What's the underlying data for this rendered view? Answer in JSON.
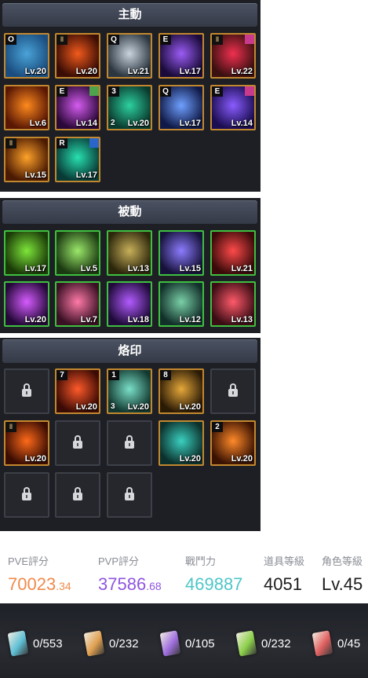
{
  "sections": {
    "active": {
      "title": "主動"
    },
    "passive": {
      "title": "被動"
    },
    "brand": {
      "title": "烙印"
    }
  },
  "active_skills": [
    {
      "name": "glaive-skill-icon",
      "tag": "O",
      "level": "Lv.20",
      "border": "gold",
      "colors": [
        "#4aa3d8",
        "#1b4e80"
      ]
    },
    {
      "name": "vortex-skill-icon",
      "level": "Lv.20",
      "border": "gold",
      "pill": "ǁ",
      "colors": [
        "#f25a1c",
        "#3a0d05"
      ]
    },
    {
      "name": "spear-dash-skill-icon",
      "tag": "Q",
      "level": "Lv.21",
      "border": "gold",
      "colors": [
        "#c9d4df",
        "#2b3640"
      ]
    },
    {
      "name": "dark-orb-skill-icon",
      "tag": "E",
      "level": "Lv.17",
      "border": "gold",
      "colors": [
        "#9b5cf5",
        "#1a0b3a"
      ]
    },
    {
      "name": "blade-rock-skill-icon",
      "level": "Lv.22",
      "border": "gold",
      "pill": "ǁ",
      "corner": "pink",
      "colors": [
        "#f03050",
        "#3a1010"
      ]
    },
    {
      "name": "flame-claw-skill-icon",
      "level": "Lv.6",
      "border": "gold",
      "colors": [
        "#ff8a1e",
        "#5a1804"
      ]
    },
    {
      "name": "purple-spikes-skill-icon",
      "tag": "E",
      "level": "Lv.14",
      "border": "gold",
      "corner": "green",
      "colors": [
        "#d55cf0",
        "#2a0838"
      ]
    },
    {
      "name": "green-hand-skill-icon",
      "tag": "3",
      "sub": "2",
      "level": "Lv.20",
      "border": "gold",
      "colors": [
        "#2dd1a0",
        "#0a3a2e"
      ]
    },
    {
      "name": "light-pillar-skill-icon",
      "tag": "Q",
      "level": "Lv.17",
      "border": "gold",
      "colors": [
        "#6fa0ff",
        "#101a48"
      ]
    },
    {
      "name": "violet-strike-skill-icon",
      "tag": "E",
      "level": "Lv.14",
      "border": "gold",
      "corner": "pink",
      "colors": [
        "#8a5cff",
        "#1a0d50"
      ]
    },
    {
      "name": "sun-seal-skill-icon",
      "level": "Lv.15",
      "border": "gold",
      "pill": "ǁ",
      "colors": [
        "#ffa22a",
        "#4a1a02"
      ]
    },
    {
      "name": "emerald-swirl-skill-icon",
      "tag": "R",
      "level": "Lv.17",
      "border": "gold",
      "corner": "blue",
      "colors": [
        "#28e0b0",
        "#083a36"
      ]
    }
  ],
  "passive_skills": [
    {
      "name": "green-burst-skill-icon",
      "level": "Lv.17",
      "colors": [
        "#7ee63a",
        "#1a3a08"
      ]
    },
    {
      "name": "green-dash-skill-icon",
      "level": "Lv.5",
      "colors": [
        "#9be86a",
        "#1c3a12"
      ]
    },
    {
      "name": "hooded-figure-skill-icon",
      "level": "Lv.13",
      "colors": [
        "#c8b05a",
        "#2c260c"
      ]
    },
    {
      "name": "reaper-skill-icon",
      "level": "Lv.15",
      "colors": [
        "#8d7cff",
        "#16123a"
      ]
    },
    {
      "name": "muscle-arm-skill-icon",
      "level": "Lv.21",
      "colors": [
        "#ff4a4a",
        "#3a0a0a"
      ]
    },
    {
      "name": "purple-comet-skill-icon",
      "level": "Lv.20",
      "colors": [
        "#d65cff",
        "#240838"
      ]
    },
    {
      "name": "roaring-beast-skill-icon",
      "level": "Lv.7",
      "colors": [
        "#ff7aa8",
        "#3a1024"
      ]
    },
    {
      "name": "violet-aura-skill-icon",
      "level": "Lv.18",
      "colors": [
        "#b25cff",
        "#200a3a"
      ]
    },
    {
      "name": "knight-skill-icon",
      "level": "Lv.12",
      "colors": [
        "#7ad0a8",
        "#12302a"
      ]
    },
    {
      "name": "red-whirl-skill-icon",
      "level": "Lv.13",
      "colors": [
        "#ff5a6a",
        "#3a0c14"
      ]
    }
  ],
  "brand_slots": [
    {
      "name": "brand-slot-locked",
      "locked": true
    },
    {
      "name": "fire-eye-brand-icon",
      "tag": "7",
      "level": "Lv.20",
      "colors": [
        "#ff5a2a",
        "#3a0a04"
      ]
    },
    {
      "name": "lightning-brand-icon",
      "tag": "1",
      "sub": "3",
      "level": "Lv.20",
      "colors": [
        "#7ae0c8",
        "#123830"
      ]
    },
    {
      "name": "golden-kick-brand-icon",
      "tag": "8",
      "level": "Lv.20",
      "colors": [
        "#e6a83a",
        "#2a1a06"
      ]
    },
    {
      "name": "brand-slot-locked",
      "locked": true
    },
    {
      "name": "flame-ring-brand-icon",
      "pill": "ǁ",
      "level": "Lv.20",
      "colors": [
        "#ff6a1a",
        "#3a0c02"
      ]
    },
    {
      "name": "brand-slot-locked",
      "locked": true
    },
    {
      "name": "brand-slot-locked",
      "locked": true
    },
    {
      "name": "spirit-hand-brand-icon",
      "level": "Lv.20",
      "colors": [
        "#3ad0c0",
        "#0c302c"
      ]
    },
    {
      "name": "fire-arrow-brand-icon",
      "tag": "2",
      "level": "Lv.20",
      "colors": [
        "#ff8a2a",
        "#3a1202"
      ]
    },
    {
      "name": "brand-slot-locked",
      "locked": true
    },
    {
      "name": "brand-slot-locked",
      "locked": true
    },
    {
      "name": "brand-slot-locked",
      "locked": true
    }
  ],
  "stats": [
    {
      "label": "PVE評分",
      "value_main": "70023",
      "value_dec": ".34",
      "color": "#f08a4b"
    },
    {
      "label": "PVP評分",
      "value_main": "37586",
      "value_dec": ".68",
      "color": "#8f55e0"
    },
    {
      "label": "戰鬥力",
      "value_main": "469887",
      "value_dec": "",
      "color": "#4ec6c8"
    },
    {
      "label": "道具等級",
      "value_main": "4051",
      "value_dec": "",
      "color": "#1b1b1b"
    },
    {
      "label": "角色等級",
      "value_main": "Lv.45",
      "value_dec": "",
      "color": "#1b1b1b"
    }
  ],
  "resources": [
    {
      "count": "0/553",
      "color": "#5fc0d6"
    },
    {
      "count": "0/232",
      "color": "#e0a050"
    },
    {
      "count": "0/105",
      "color": "#a070e0"
    },
    {
      "count": "0/232",
      "color": "#8cd04a"
    },
    {
      "count": "0/45",
      "color": "#e06060"
    }
  ]
}
